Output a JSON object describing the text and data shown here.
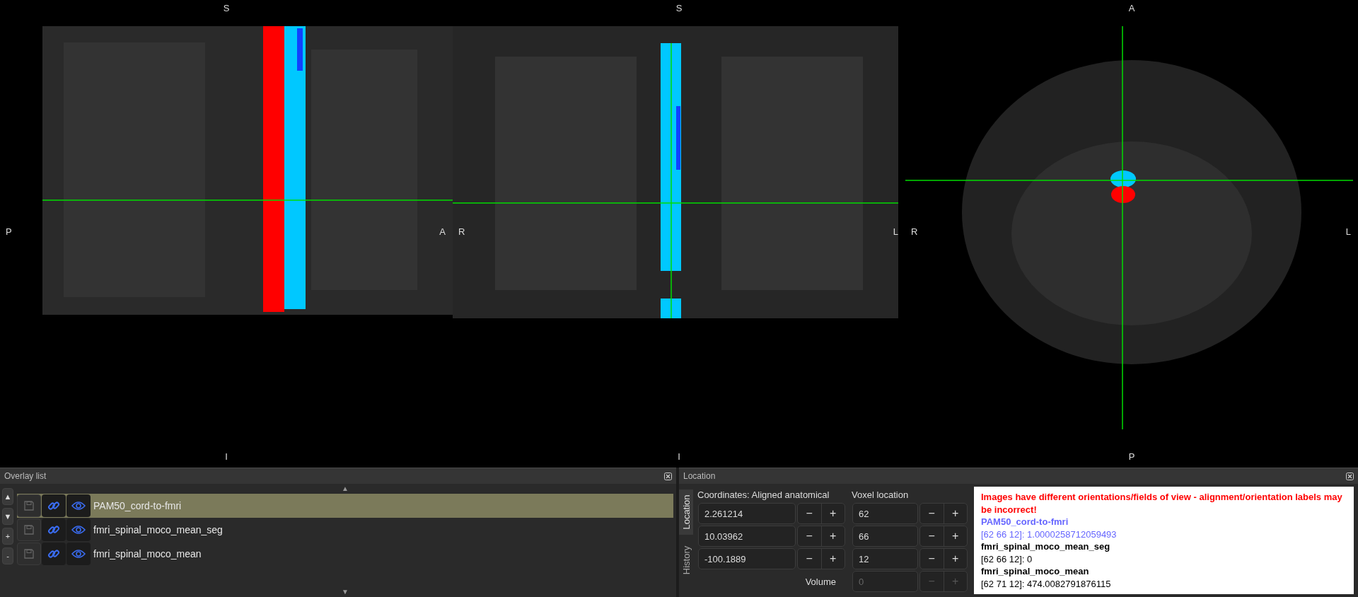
{
  "views": [
    {
      "kind": "sagittal",
      "top": "S",
      "bottom": "I",
      "left": "P",
      "right": "A"
    },
    {
      "kind": "coronal",
      "top": "S",
      "bottom": "I",
      "left": "R",
      "right": "L"
    },
    {
      "kind": "axial",
      "top": "A",
      "bottom": "P",
      "left": "R",
      "right": "L"
    }
  ],
  "overlay_list": {
    "title": "Overlay list",
    "move_up": "▲",
    "move_down": "▼",
    "add": "+",
    "remove": "-",
    "scroll_up": "▲",
    "scroll_down": "▼",
    "overlays": [
      {
        "name": "PAM50_cord-to-fmri",
        "selected": true,
        "visible": true
      },
      {
        "name": "fmri_spinal_moco_mean_seg",
        "selected": false,
        "visible": true
      },
      {
        "name": "fmri_spinal_moco_mean",
        "selected": false,
        "visible": true
      }
    ]
  },
  "location": {
    "title": "Location",
    "tabs": [
      {
        "label": "Location",
        "selected": true
      },
      {
        "label": "History",
        "selected": false
      }
    ],
    "coordinates_label": "Coordinates: Aligned anatomical",
    "voxel_label": "Voxel location",
    "volume_label": "Volume",
    "coordinates": [
      {
        "value": "2.261214",
        "decrement": "−",
        "increment": "+"
      },
      {
        "value": "10.03962",
        "decrement": "−",
        "increment": "+"
      },
      {
        "value": "-100.1889",
        "decrement": "−",
        "increment": "+"
      }
    ],
    "voxels": [
      {
        "value": "62",
        "decrement": "−",
        "increment": "+",
        "disabled": false
      },
      {
        "value": "66",
        "decrement": "−",
        "increment": "+",
        "disabled": false
      },
      {
        "value": "12",
        "decrement": "−",
        "increment": "+",
        "disabled": false
      },
      {
        "value": "0",
        "decrement": "−",
        "increment": "+",
        "disabled": true
      }
    ],
    "info": [
      {
        "kind": "warning",
        "text": "Images have different orientations/fields of view - alignment/orientation labels may be incorrect!"
      },
      {
        "kind": "name",
        "text": "PAM50_cord-to-fmri",
        "selected": true
      },
      {
        "kind": "value",
        "text": "[62 66 12]: 1.0000258712059493",
        "selected": true
      },
      {
        "kind": "name",
        "text": "fmri_spinal_moco_mean_seg",
        "selected": false
      },
      {
        "kind": "value",
        "text": "[62 66 12]: 0",
        "selected": false
      },
      {
        "kind": "name",
        "text": "fmri_spinal_moco_mean",
        "selected": false
      },
      {
        "kind": "value",
        "text": "[62 71 12]: 474.0082791876115",
        "selected": false
      }
    ]
  }
}
